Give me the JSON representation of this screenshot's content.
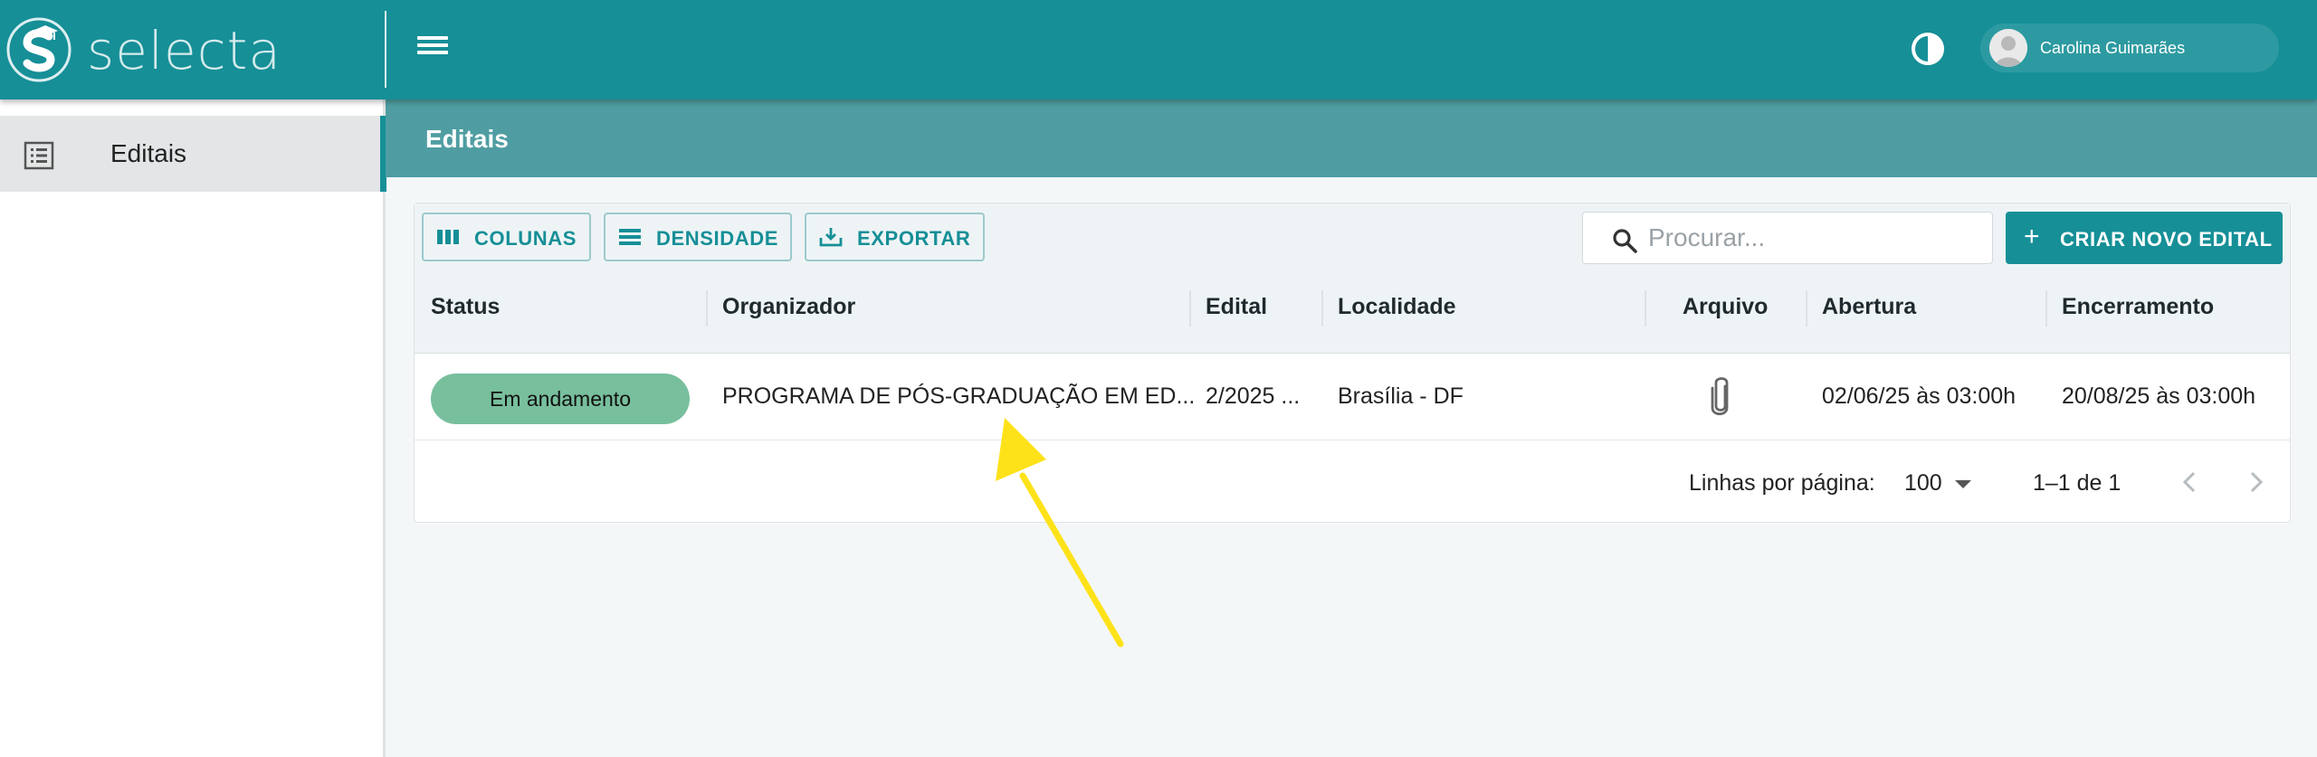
{
  "app": {
    "logo_text": "selecta",
    "brand_color": "#168f97",
    "user_name": "Carolina Guimarães",
    "icons": [
      "selecta-logo",
      "menu-icon",
      "contrast-icon",
      "avatar-icon"
    ]
  },
  "sidebar": {
    "items": [
      {
        "label": "Editais",
        "icon": "list-icon",
        "active": true
      }
    ]
  },
  "page": {
    "title": "Editais"
  },
  "toolbar": {
    "columns_label": "COLUNAS",
    "density_label": "DENSIDADE",
    "export_label": "EXPORTAR",
    "search_placeholder": "Procurar...",
    "search_value": "",
    "create_label": "CRIAR NOVO EDITAL"
  },
  "table": {
    "columns": [
      "Status",
      "Organizador",
      "Edital",
      "Localidade",
      "Arquivo",
      "Abertura",
      "Encerramento"
    ],
    "rows": [
      {
        "status": "Em andamento",
        "status_color": "#78bf9d",
        "organizador": "PROGRAMA DE PÓS-GRADUAÇÃO EM ED...",
        "edital": "2/2025 ...",
        "localidade": "Brasília - DF",
        "arquivo_icon": "paperclip-icon",
        "abertura": "02/06/25 às 03:00h",
        "encerramento": "20/08/25 às 03:00h"
      }
    ]
  },
  "pagination": {
    "rows_per_page_label": "Linhas por página:",
    "rows_per_page_value": "100",
    "range_text": "1–1 de 1"
  },
  "annotation": {
    "arrow_color": "#fde21a"
  }
}
